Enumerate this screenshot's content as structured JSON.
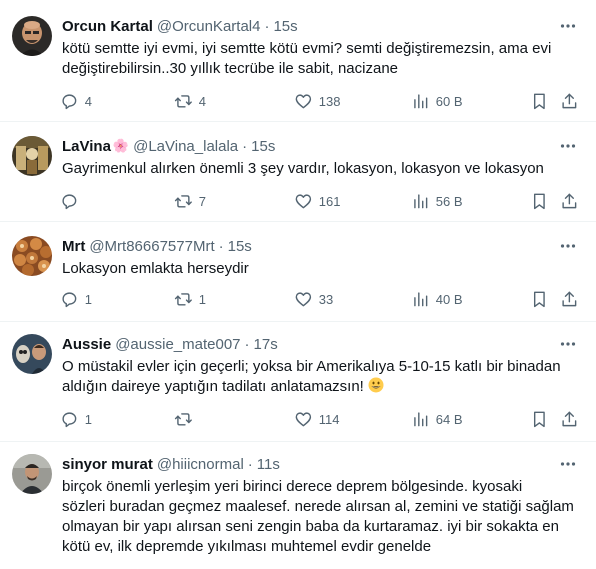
{
  "tweets": [
    {
      "name": "Orcun Kartal",
      "handle": "@OrcunKartal4",
      "sep": "·",
      "time": "15s",
      "lines": [
        "kötü semtte iyi evmi, iyi semtte kötü evmi? semti değiştiremezsin, ama evi",
        "değiştirebilirsin..30 yıllık tecrübe ile sabit, nacizane"
      ],
      "replies": "4",
      "retweets": "4",
      "likes": "138",
      "views": "60 B",
      "avatar_icon": "avatar-bald-man"
    },
    {
      "name": "LaVina",
      "badge": "🌸",
      "handle": "@LaVina_lalala",
      "sep": "·",
      "time": "15s",
      "lines": [
        "Gayrimenkul alırken önemli 3 şey vardır, lokasyon, lokasyon ve lokasyon"
      ],
      "replies": "",
      "retweets": "7",
      "likes": "161",
      "views": "56 B",
      "avatar_icon": "avatar-painting"
    },
    {
      "name": "Mrt",
      "handle": "@Mrt86667577Mrt",
      "sep": "·",
      "time": "15s",
      "lines": [
        "Lokasyon emlakta herseydir"
      ],
      "replies": "1",
      "retweets": "1",
      "likes": "33",
      "views": "40 B",
      "avatar_icon": "avatar-food"
    },
    {
      "name": "Aussie",
      "handle": "@aussie_mate007",
      "sep": "·",
      "time": "17s",
      "lines": [
        "O müstakil evler için geçerli; yoksa bir Amerikalıya 5-10-15 katlı bir binadan",
        "aldığın daireye yaptığın tadilatı anlatamazsın!"
      ],
      "trailing_emoji": "grinning-face-emoji",
      "replies": "1",
      "retweets": "",
      "likes": "114",
      "views": "64 B",
      "avatar_icon": "avatar-owl-man"
    },
    {
      "name": "sinyor murat",
      "handle": "@hiiicnormal",
      "sep": "·",
      "time": "11s",
      "lines": [
        "birçok önemli yerleşim yeri birinci derece deprem bölgesinde. kyosaki",
        "sözleri buradan geçmez maalesef. nerede alırsan al, zemini ve statiği sağlam",
        "olmayan bir yapı alırsan seni zengin baba da kurtaramaz. iyi bir sokakta en",
        "kötü ev, ilk depremde yıkılması muhtemel evdir genelde"
      ],
      "avatar_icon": "avatar-man-photo"
    }
  ],
  "colors": {
    "text": "#0f1419",
    "secondary": "#536471",
    "divider": "#eff3f4"
  }
}
